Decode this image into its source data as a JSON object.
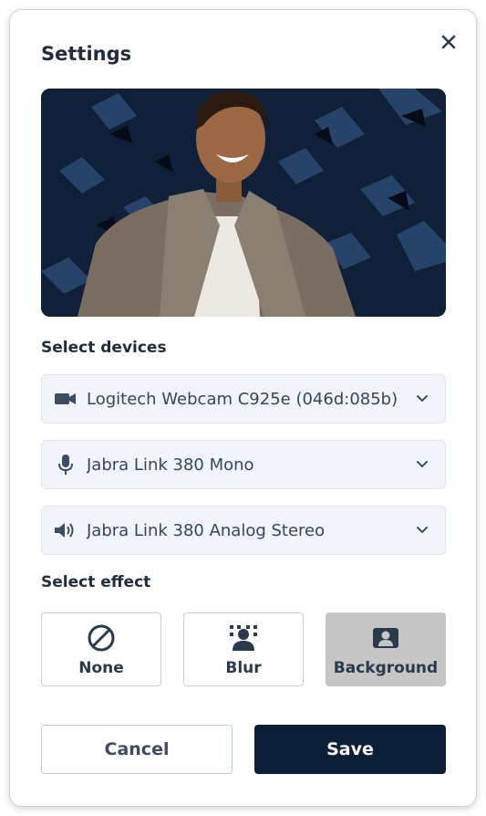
{
  "dialog": {
    "title": "Settings"
  },
  "icons": {
    "close": "close-icon",
    "camera": "video-camera-icon",
    "mic": "microphone-icon",
    "speaker": "speaker-icon",
    "chevron": "chevron-down-icon",
    "none": "block-icon",
    "blur": "blur-icon",
    "background": "background-portrait-icon"
  },
  "devices": {
    "label": "Select devices",
    "camera": "Logitech Webcam C925e (046d:085b)",
    "microphone": "Jabra Link 380 Mono",
    "speaker": "Jabra Link 380 Analog Stereo"
  },
  "effects": {
    "label": "Select effect",
    "none": "None",
    "blur": "Blur",
    "background": "Background",
    "selected": "Background"
  },
  "actions": {
    "cancel": "Cancel",
    "save": "Save"
  },
  "colors": {
    "primary": "#0d1f36",
    "select_bg": "#f1f5fb",
    "selected_effect_bg": "#c6c6c6"
  }
}
